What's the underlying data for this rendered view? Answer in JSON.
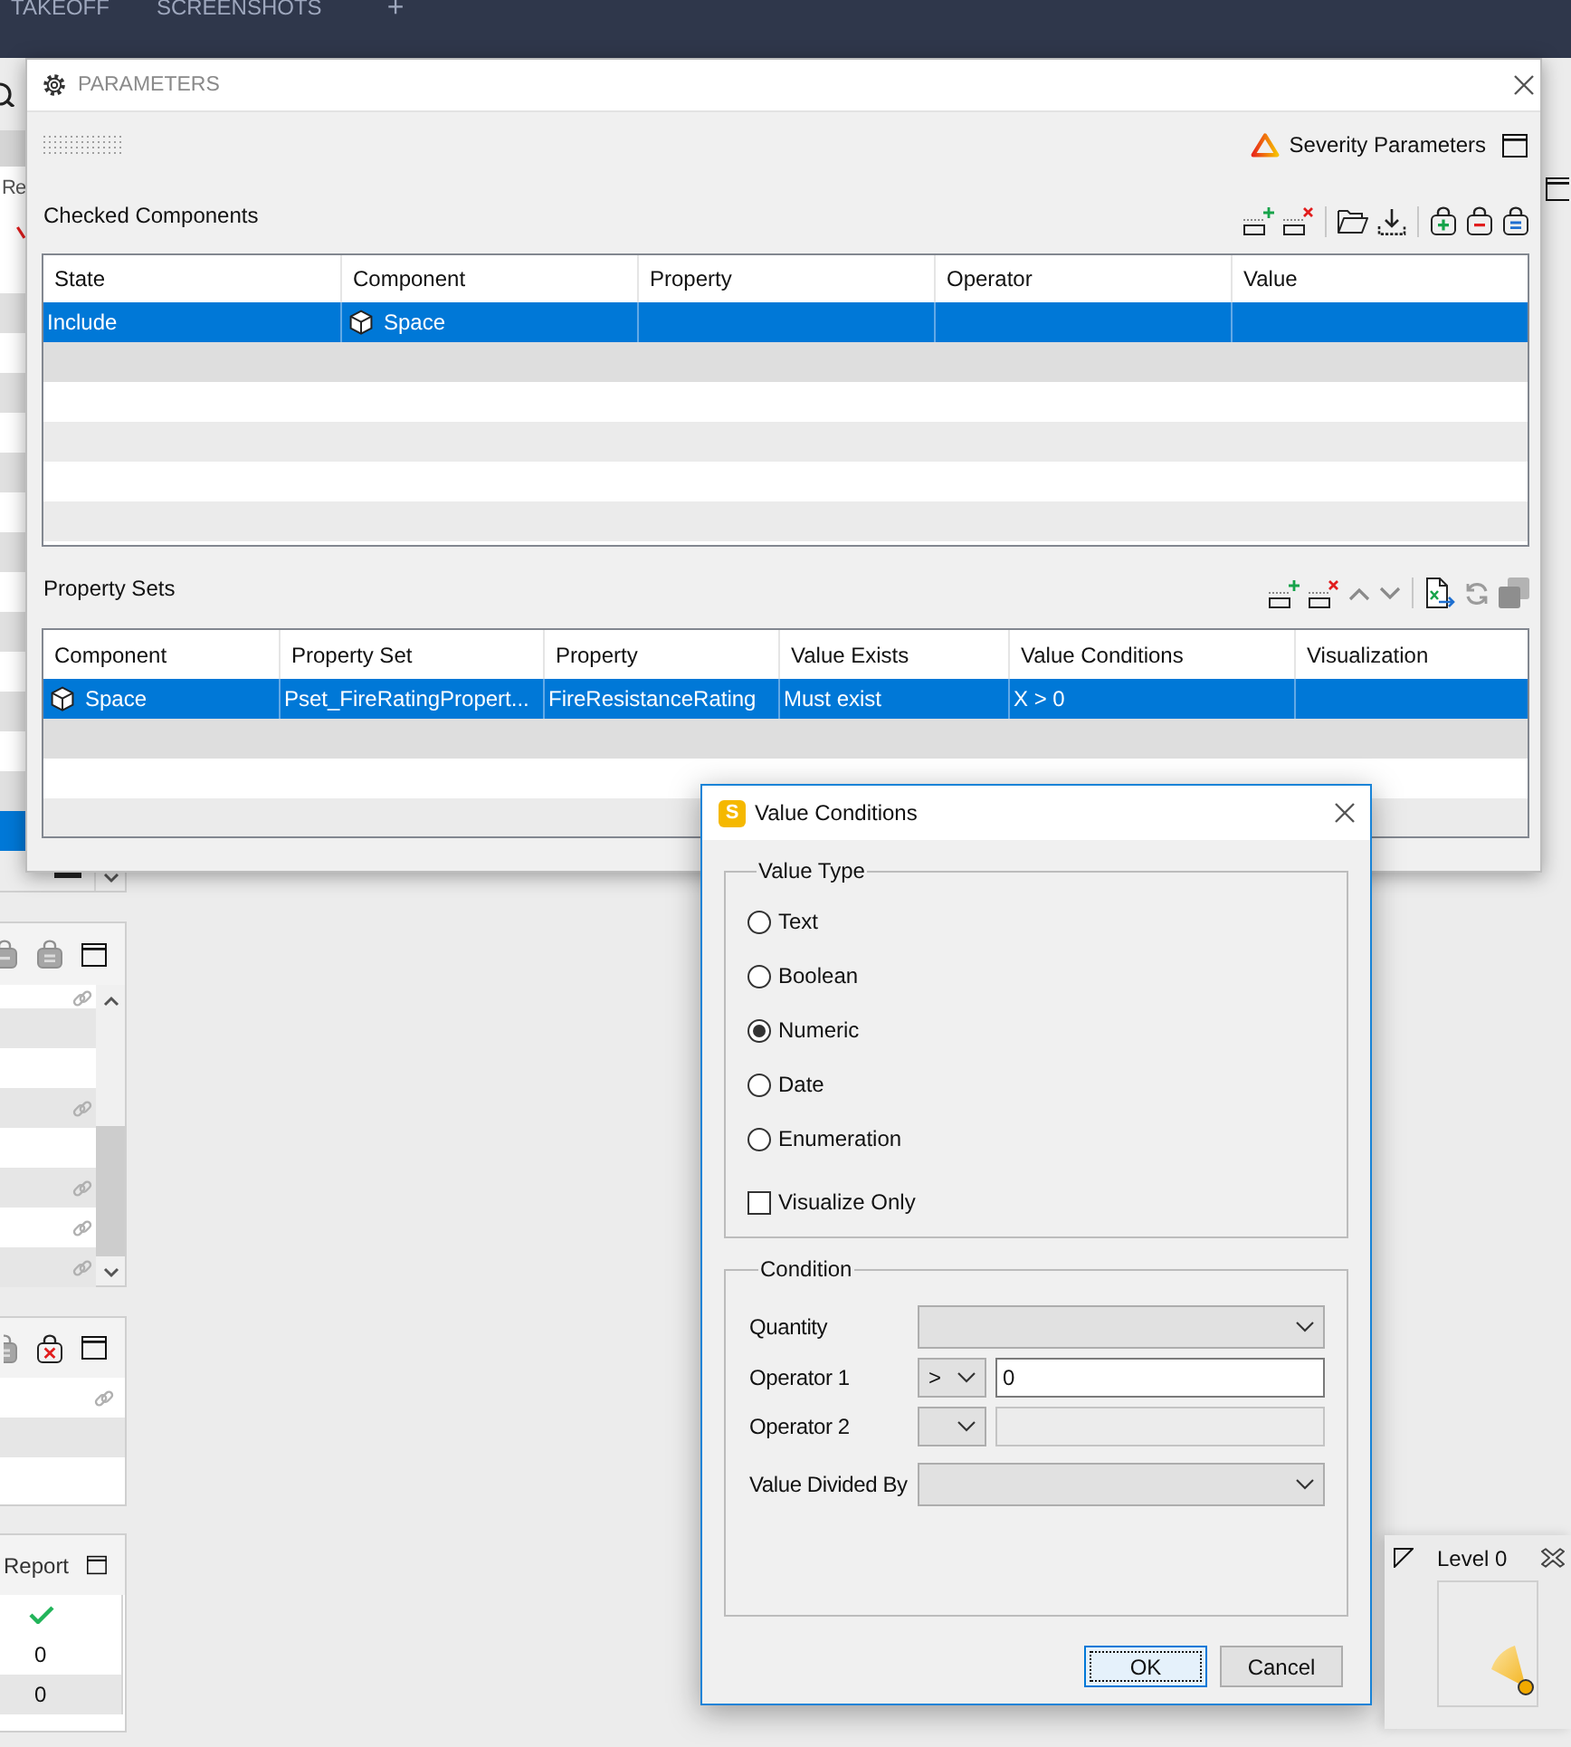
{
  "app_bar": {
    "tabs": [
      {
        "label": "TAKEOFF",
        "selected": false
      },
      {
        "label": "SCREENSHOTS",
        "selected": false
      }
    ],
    "add_label": "+"
  },
  "side_panels": [
    {
      "kind": "list",
      "title": "Re",
      "rows": [
        {
          "selected": false
        },
        {
          "selected": false
        },
        {
          "selected": false
        },
        {
          "selected": false
        },
        {
          "selected": false
        },
        {
          "selected": false
        },
        {
          "selected": false
        },
        {
          "selected": false
        },
        {
          "selected": false
        },
        {
          "selected": false
        },
        {
          "selected": false
        },
        {
          "selected": false
        },
        {
          "selected": false
        },
        {
          "selected": false
        },
        {
          "selected": true
        }
      ]
    },
    {
      "kind": "scrolling",
      "rows": [
        {
          "linked": true
        },
        {
          "linked": false
        },
        {
          "linked": false
        },
        {
          "linked": true
        },
        {
          "linked": false
        },
        {
          "linked": true
        },
        {
          "linked": true
        },
        {
          "linked": true
        }
      ]
    },
    {
      "kind": "plain",
      "rows": [
        {
          "linked": true
        },
        {
          "linked": false
        },
        {
          "linked": false
        }
      ]
    },
    {
      "kind": "report",
      "title": "Report",
      "rows": [
        {
          "kind": "check"
        },
        {
          "kind": "text",
          "text": "0"
        },
        {
          "kind": "text",
          "text": "0"
        }
      ]
    }
  ],
  "parameters_window": {
    "title": "PARAMETERS",
    "severity_label": "Severity Parameters",
    "checked_components": {
      "title": "Checked Components",
      "columns": [
        "State",
        "Component",
        "Property",
        "Operator",
        "Value"
      ],
      "rows": [
        {
          "selected": true,
          "cells": [
            {
              "kind": "text",
              "text": "Include"
            },
            {
              "kind": "component",
              "text": "Space"
            },
            null,
            null,
            null
          ]
        },
        {
          "selected": false
        },
        {
          "selected": false
        },
        {
          "selected": false
        },
        {
          "selected": false
        },
        {
          "selected": false
        }
      ]
    },
    "property_sets": {
      "title": "Property Sets",
      "columns": [
        "Component",
        "Property Set",
        "Property",
        "Value Exists",
        "Value Conditions",
        "Visualization"
      ],
      "rows": [
        {
          "selected": true,
          "cells": [
            {
              "kind": "component",
              "text": "Space"
            },
            {
              "kind": "text",
              "text": "Pset_FireRatingPropert..."
            },
            {
              "kind": "text",
              "text": "FireResistanceRating"
            },
            {
              "kind": "text",
              "text": "Must exist"
            },
            {
              "kind": "text",
              "text": "X > 0"
            },
            null
          ]
        },
        {
          "selected": false
        },
        {
          "selected": false
        },
        {
          "selected": false
        }
      ]
    }
  },
  "value_conditions_dialog": {
    "logo": "S",
    "title": "Value Conditions",
    "value_type": {
      "label": "Value Type",
      "options": [
        {
          "label": "Text",
          "selected": false
        },
        {
          "label": "Boolean",
          "selected": false
        },
        {
          "label": "Numeric",
          "selected": true
        },
        {
          "label": "Date",
          "selected": false
        },
        {
          "label": "Enumeration",
          "selected": false
        }
      ],
      "visualize_only": {
        "label": "Visualize Only",
        "checked": false
      }
    },
    "condition": {
      "label": "Condition",
      "rows": [
        {
          "label": "Quantity",
          "kind": "dropdown"
        },
        {
          "label": "Operator 1",
          "kind": "operator",
          "operator": ">",
          "field": {
            "value": "0",
            "disabled": false
          }
        },
        {
          "label": "Operator 2",
          "kind": "operator",
          "field": {
            "disabled": true
          }
        },
        {
          "label": "Value Divided By",
          "kind": "dropdown"
        }
      ]
    },
    "buttons": [
      {
        "label": "OK",
        "default": true
      },
      {
        "label": "Cancel",
        "default": false
      }
    ]
  },
  "level_widget": {
    "label": "Level 0"
  }
}
